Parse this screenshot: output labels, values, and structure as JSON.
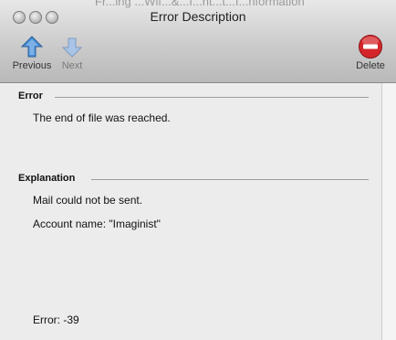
{
  "window": {
    "title": "Error Description",
    "background_title_fragment": "Fr...ing ...Wif...&...I...nt...t...I...nformation"
  },
  "toolbar": {
    "previous_label": "Previous",
    "next_label": "Next",
    "delete_label": "Delete"
  },
  "error_section": {
    "heading": "Error",
    "message": "The end of file was reached."
  },
  "explanation_section": {
    "heading": "Explanation",
    "line1": "Mail could not be sent.",
    "line2": "Account name: \"Imaginist\"",
    "error_code": "Error: -39"
  },
  "colors": {
    "arrow_blue": "#4a8fd6",
    "delete_red": "#d4262a"
  }
}
